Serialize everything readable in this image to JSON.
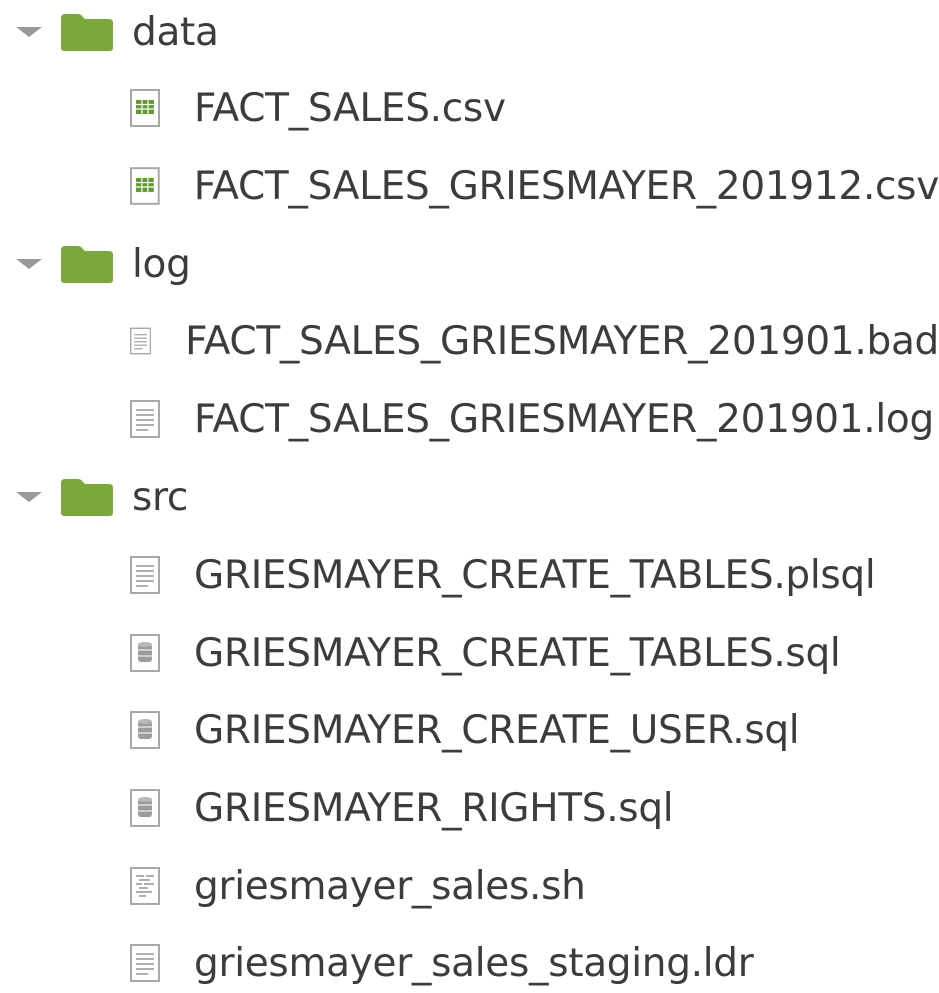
{
  "tree": {
    "folders": [
      {
        "name": "data",
        "files": [
          {
            "name": "FACT_SALES.csv",
            "icon": "spreadsheet-icon"
          },
          {
            "name": "FACT_SALES_GRIESMAYER_201912.csv",
            "icon": "spreadsheet-icon"
          }
        ]
      },
      {
        "name": "log",
        "files": [
          {
            "name": "FACT_SALES_GRIESMAYER_201901.bad",
            "icon": "text-file-icon"
          },
          {
            "name": "FACT_SALES_GRIESMAYER_201901.log",
            "icon": "text-file-icon"
          }
        ]
      },
      {
        "name": "src",
        "files": [
          {
            "name": "GRIESMAYER_CREATE_TABLES.plsql",
            "icon": "text-file-icon"
          },
          {
            "name": "GRIESMAYER_CREATE_TABLES.sql",
            "icon": "database-file-icon"
          },
          {
            "name": "GRIESMAYER_CREATE_USER.sql",
            "icon": "database-file-icon"
          },
          {
            "name": "GRIESMAYER_RIGHTS.sql",
            "icon": "database-file-icon"
          },
          {
            "name": "griesmayer_sales.sh",
            "icon": "script-file-icon"
          },
          {
            "name": "griesmayer_sales_staging.ldr",
            "icon": "text-file-icon"
          }
        ]
      }
    ]
  },
  "colors": {
    "folder": "#7aa83a",
    "spreadsheet": "#5e9a2c",
    "file_outline": "#a8a8a8",
    "chevron": "#9a9a9a",
    "text": "#3c3c3c"
  }
}
